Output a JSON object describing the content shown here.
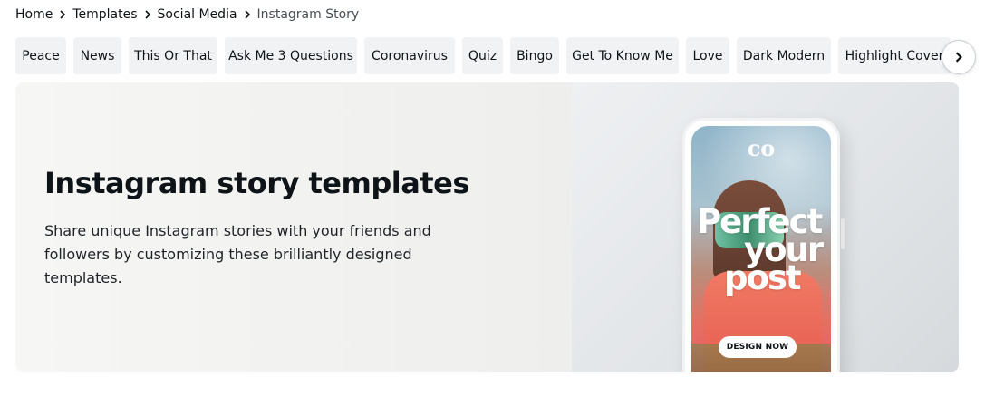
{
  "breadcrumb": {
    "items": [
      "Home",
      "Templates",
      "Social Media"
    ],
    "current": "Instagram Story"
  },
  "chips": [
    "Peace",
    "News",
    "This Or That",
    "Ask Me 3 Questions",
    "Coronavirus",
    "Quiz",
    "Bingo",
    "Get To Know Me",
    "Love",
    "Dark Modern",
    "Highlight Cover"
  ],
  "icons": {
    "breadcrumb_separator": "chevron-right-icon",
    "scroll_next": "chevron-right-icon"
  },
  "hero": {
    "title": "Instagram story templates",
    "description": "Share unique Instagram stories with your friends and followers by customizing these brilliantly designed templates.",
    "image": {
      "logo_text": "co",
      "headline_line1": "Perfect",
      "headline_line2": "your",
      "headline_line3": "post",
      "cta_label": "DESIGN NOW"
    }
  },
  "colors": {
    "chip_background": "#f1f2f4",
    "hero_background": "#f6f6f4",
    "text_primary": "#0e1318"
  }
}
